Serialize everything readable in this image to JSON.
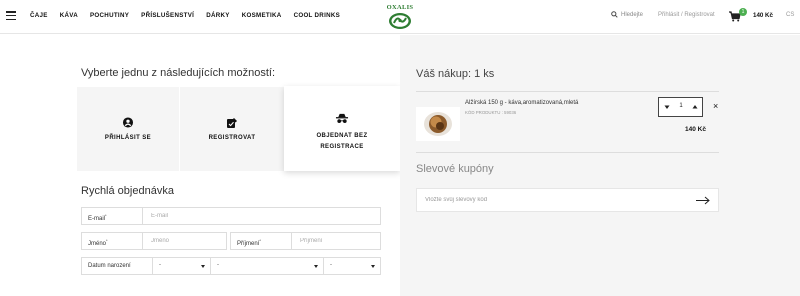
{
  "header": {
    "nav": [
      "ČAJE",
      "KÁVA",
      "POCHUTINY",
      "PŘÍSLUŠENSTVÍ",
      "DÁRKY",
      "KOSMETIKA",
      "COOL DRINKS"
    ],
    "logo_text": "OXALIS",
    "search_label": "Hledejte",
    "login_label": "Přihlásit / Registrovat",
    "cart_count": "1",
    "cart_total": "140 Kč",
    "language": "CS"
  },
  "checkout": {
    "choose_title": "Vyberte jednu z následujících možností:",
    "options": {
      "login": "PŘIHLÁSIT SE",
      "register": "REGISTROVAT",
      "guest_line1": "OBJEDNAT BEZ",
      "guest_line2": "REGISTRACE"
    },
    "quick_title": "Rychlá objednávka",
    "form": {
      "email_label": "E-mail",
      "email_placeholder": "E-mail",
      "firstname_label": "Jméno",
      "firstname_placeholder": "Jméno",
      "lastname_label": "Příjmení",
      "lastname_placeholder": "Příjmení",
      "birthdate_label": "Datum narození",
      "day_value": "-",
      "month_value": "-",
      "year_value": "-",
      "required_mark": "*"
    }
  },
  "cart": {
    "title": "Váš nákup: 1 ks",
    "product_name": "Alžírská 150 g - káva,aromatizovaná,mletá",
    "product_code": "KÓD PRODUKTU : 59036",
    "quantity": "1",
    "price": "140 Kč",
    "remove_symbol": "×",
    "coupon_title": "Slevové kupóny",
    "coupon_placeholder": "Vložte svůj slevový kód"
  },
  "colors": {
    "accent_green": "#2e7d32",
    "badge_green": "#4caf50",
    "right_panel_bg": "#f5f5f5"
  },
  "icons": [
    "hamburger-icon",
    "search-icon",
    "cart-icon",
    "user-icon",
    "register-icon",
    "incognito-icon",
    "minus-icon",
    "plus-icon",
    "arrow-right-icon"
  ]
}
